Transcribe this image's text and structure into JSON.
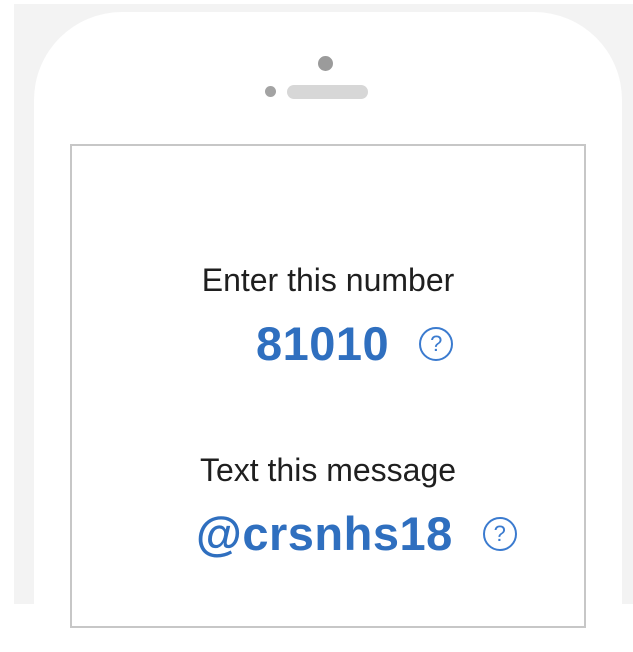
{
  "step_number": {
    "label": "Enter this number",
    "value": "81010",
    "help_glyph": "?",
    "help_icon": "question-circle-icon"
  },
  "step_message": {
    "label": "Text this message",
    "value": "@crsnhs18",
    "help_glyph": "?",
    "help_icon": "question-circle-icon"
  },
  "colors": {
    "accent": "#2f6fbf",
    "text": "#1f1f1f",
    "frame_border": "#c7c7c7",
    "backdrop": "#f3f3f3"
  }
}
